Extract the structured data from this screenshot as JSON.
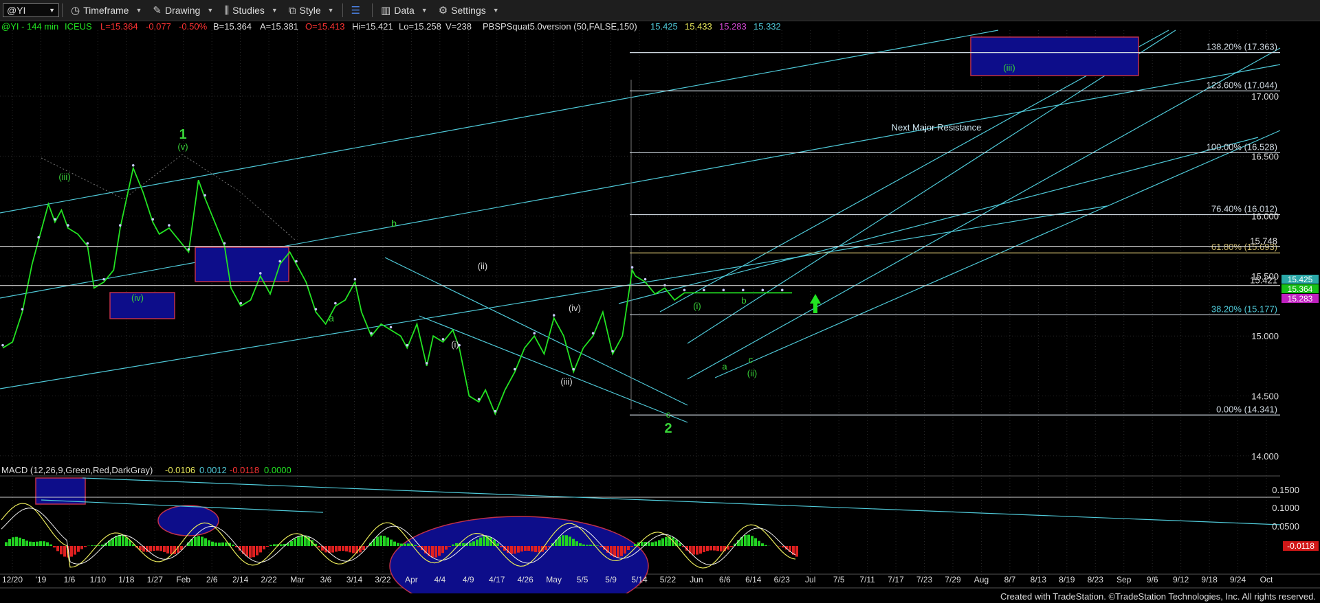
{
  "toolbar": {
    "symbol": "@YI",
    "timeframe": "Timeframe",
    "drawing": "Drawing",
    "studies": "Studies",
    "style": "Style",
    "data": "Data",
    "settings": "Settings"
  },
  "header": {
    "symbol": "@YI - 144 min",
    "exchange": "ICEUS",
    "last": "L=15.364",
    "change": "-0.077",
    "pct": "-0.50%",
    "bid": "B=15.364",
    "ask": "A=15.381",
    "open": "O=15.413",
    "high": "Hi=15.421",
    "low": "Lo=15.258",
    "volume": "V=238",
    "study": "PBSPSquat5.0version (50,FALSE,150)",
    "study_vals": [
      "15.425",
      "15.433",
      "15.283",
      "15.332"
    ]
  },
  "macd": {
    "label": "MACD (12,26,9,Green,Red,DarkGray)",
    "vals": [
      "-0.0106",
      "0.0012",
      "-0.0118",
      "0.0000"
    ],
    "axis_ticks": [
      "0.1500",
      "0.1000",
      "0.0500"
    ],
    "last_tag": "-0.0118"
  },
  "colors": {
    "price": "#22e322",
    "teal": "#4fc9d8",
    "fib": "#cfd8e0",
    "fib_gold": "#c8b46a",
    "box": "#0d0d8a",
    "box_border": "#c0314a",
    "wave_green": "#38d338",
    "wave_white": "#d8d8d8"
  },
  "chart_data": {
    "type": "line",
    "title": "",
    "ylim": [
      13.85,
      17.55
    ],
    "y_ticks": [
      14.0,
      14.5,
      15.0,
      15.5,
      16.0,
      16.5,
      17.0
    ],
    "y_tick_labels": [
      "14.000",
      "14.500",
      "15.000",
      "15.500",
      "16.000",
      "16.500",
      "17.000"
    ],
    "x_tick_labels": [
      "12/20",
      "'19",
      "1/6",
      "1/10",
      "1/18",
      "1/27",
      "Feb",
      "2/6",
      "2/14",
      "2/22",
      "Mar",
      "3/6",
      "3/14",
      "3/22",
      "Apr",
      "4/4",
      "4/9",
      "4/17",
      "4/26",
      "May",
      "5/5",
      "5/9",
      "5/14",
      "5/22",
      "Jun",
      "6/6",
      "6/14",
      "6/23",
      "Jul",
      "7/5",
      "7/11",
      "7/17",
      "7/23",
      "7/29",
      "Aug",
      "8/7",
      "8/13",
      "8/19",
      "8/23",
      "Sep",
      "9/6",
      "9/12",
      "9/18",
      "9/24",
      "Oct"
    ],
    "x_range": [
      0,
      100
    ],
    "series": [
      {
        "x": [
          0,
          1.5,
          3,
          4.5,
          5.5,
          7,
          8,
          9,
          10,
          11.5,
          13,
          14,
          15.5,
          17,
          18,
          19,
          20,
          21.5,
          23,
          24,
          25.5,
          27,
          28.5,
          30,
          31,
          32.5,
          34,
          35,
          36.5,
          38,
          39.5,
          41,
          42.5,
          44,
          45,
          46.5,
          48,
          49.5,
          51,
          52.5,
          54,
          55,
          56.5,
          58,
          59.5,
          61,
          62,
          63.5,
          65,
          66,
          67.5,
          69,
          70,
          71.5,
          73,
          74,
          75.5,
          77,
          78.5,
          80,
          81.5,
          83,
          84.5,
          86,
          87.5,
          89,
          90.5,
          92,
          93.5,
          95,
          96.5,
          97,
          98.5,
          100,
          101.5,
          103,
          104.5,
          106,
          107.5,
          109,
          110.5,
          112,
          113.5,
          115,
          116.5,
          118,
          119.5,
          121
        ],
        "y": [
          14.9,
          14.95,
          15.2,
          15.6,
          15.8,
          16.1,
          15.95,
          16.05,
          15.9,
          15.85,
          15.75,
          15.4,
          15.45,
          15.55,
          15.9,
          16.15,
          16.4,
          16.2,
          15.95,
          15.85,
          15.9,
          15.8,
          15.7,
          16.3,
          16.15,
          15.95,
          15.75,
          15.4,
          15.25,
          15.3,
          15.5,
          15.35,
          15.6,
          15.7,
          15.6,
          15.45,
          15.2,
          15.1,
          15.25,
          15.3,
          15.45,
          15.2,
          15.0,
          15.1,
          15.05,
          15.0,
          14.9,
          15.1,
          14.75,
          15.0,
          14.95,
          15.05,
          14.9,
          14.5,
          14.45,
          14.55,
          14.35,
          14.55,
          14.7,
          14.9,
          15.0,
          14.85,
          15.15,
          15.0,
          14.7,
          14.9,
          15.0,
          15.2,
          14.85,
          15.0,
          15.55,
          15.5,
          15.45,
          15.35,
          15.4,
          15.3,
          15.36,
          15.36,
          15.36,
          15.36,
          15.36,
          15.36,
          15.36,
          15.36,
          15.36,
          15.36,
          15.36,
          15.36
        ]
      }
    ],
    "fib_levels": [
      {
        "label": "138.20% (17.363)",
        "value": 17.363
      },
      {
        "label": "123.60% (17.044)",
        "value": 17.044
      },
      {
        "label": "100.00% (16.528)",
        "value": 16.528
      },
      {
        "label": "76.40% (16.012)",
        "value": 16.012
      },
      {
        "label": "61.80% (15.693)",
        "value": 15.693
      },
      {
        "label": "38.20% (15.177)",
        "value": 15.177
      },
      {
        "label": "0.00% (14.341)",
        "value": 14.341
      }
    ],
    "hlines": [
      {
        "label": "15.748",
        "value": 15.748
      },
      {
        "label": "15.421",
        "value": 15.421
      }
    ],
    "price_tags": [
      {
        "label": "15.425",
        "value": 15.425,
        "color": "#2aa8a8"
      },
      {
        "label": "15.364",
        "value": 15.364,
        "color": "#18c018"
      },
      {
        "label": "15.283",
        "value": 15.283,
        "color": "#c020c0"
      }
    ],
    "annotations": [
      "1",
      "(v)",
      "(iii)",
      "(iv)",
      "b",
      "a",
      "(ii)",
      "(i)",
      "(iv)",
      "(iii)",
      "c",
      "2",
      "(i)",
      "b",
      "a",
      "c",
      "(ii)",
      "(iii)",
      "Next Major Resistance"
    ]
  },
  "footer": "Created with TradeStation. ©TradeStation Technologies, Inc. All rights reserved."
}
